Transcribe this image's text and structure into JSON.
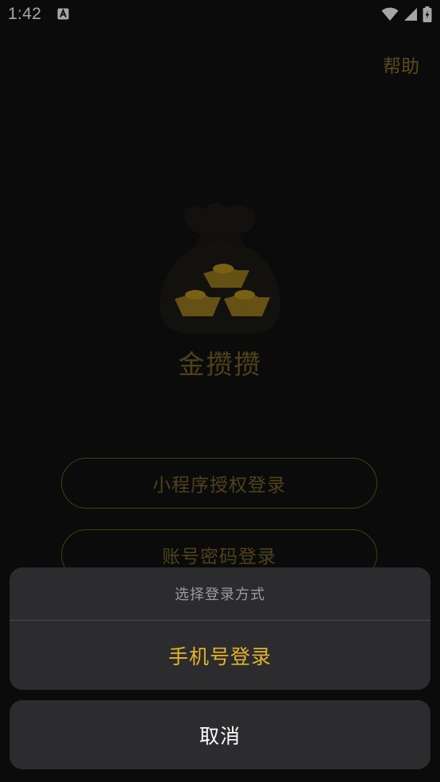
{
  "status_bar": {
    "time": "1:42",
    "notification_icon": "app-notification-icon",
    "icons": [
      "wifi-icon",
      "signal-icon",
      "battery-icon"
    ]
  },
  "header": {
    "help_label": "帮助"
  },
  "app": {
    "name": "金攒攒",
    "logo_icon": "money-bag-gold-ingots-icon"
  },
  "login_options": {
    "mini_program_label": "小程序授权登录",
    "password_label": "账号密码登录"
  },
  "action_sheet": {
    "title": "选择登录方式",
    "items": [
      {
        "label": "手机号登录"
      }
    ],
    "cancel_label": "取消"
  },
  "colors": {
    "background": "#111111",
    "gold_dim": "#7a6624",
    "gold_accent": "#e3b42a",
    "sheet_bg": "#2c2c2e"
  }
}
